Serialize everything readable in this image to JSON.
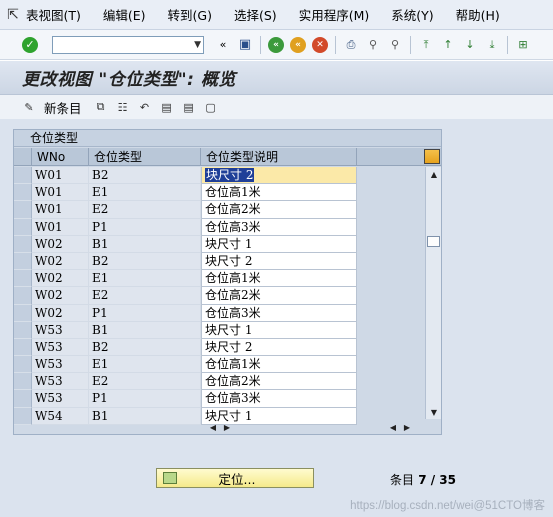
{
  "menubar": {
    "items": [
      "表视图(T)",
      "编辑(E)",
      "转到(G)",
      "选择(S)",
      "实用程序(M)",
      "系统(Y)",
      "帮助(H)"
    ]
  },
  "toolbar": {
    "command_value": "",
    "back_symbol": "«"
  },
  "title": "更改视图 \"仓位类型\": 概览",
  "app_toolbar": {
    "new_entries": "新条目"
  },
  "table": {
    "title": "仓位类型",
    "columns": [
      "WNo",
      "仓位类型",
      "仓位类型说明"
    ],
    "rows": [
      [
        "W01",
        "B2",
        "块尺寸 2"
      ],
      [
        "W01",
        "E1",
        "仓位高1米"
      ],
      [
        "W01",
        "E2",
        "仓位高2米"
      ],
      [
        "W01",
        "P1",
        "仓位高3米"
      ],
      [
        "W02",
        "B1",
        "块尺寸 1"
      ],
      [
        "W02",
        "B2",
        "块尺寸 2"
      ],
      [
        "W02",
        "E1",
        "仓位高1米"
      ],
      [
        "W02",
        "E2",
        "仓位高2米"
      ],
      [
        "W02",
        "P1",
        "仓位高3米"
      ],
      [
        "W53",
        "B1",
        "块尺寸 1"
      ],
      [
        "W53",
        "B2",
        "块尺寸 2"
      ],
      [
        "W53",
        "E1",
        "仓位高1米"
      ],
      [
        "W53",
        "E2",
        "仓位高2米"
      ],
      [
        "W53",
        "P1",
        "仓位高3米"
      ],
      [
        "W54",
        "B1",
        "块尺寸 1"
      ]
    ]
  },
  "footer": {
    "locate_label": "定位...",
    "entries_label": "条目",
    "entries_value": "7 / 35"
  },
  "watermark": "https://blog.csdn.net/wei@51CTO博客"
}
